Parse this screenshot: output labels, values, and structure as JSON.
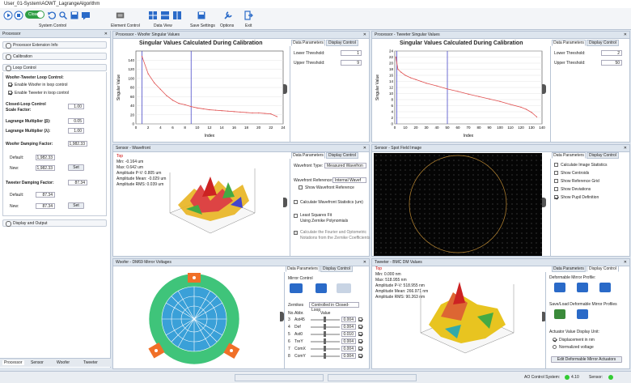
{
  "window": {
    "title": "User_01-System\\AOWT_LagrangeAlgorithm"
  },
  "toolbar": {
    "system_label": "System Control",
    "toggle_label": "Closed",
    "element_label": "Element Control",
    "data_view_label": "Data View",
    "save_label": "Save Settings",
    "options_label": "Options",
    "exit_label": "Exit"
  },
  "left": {
    "title": "Processor",
    "sec_ext": "Processor Extension Info",
    "sec_cal": "Calibration",
    "sec_loop": "Loop Control",
    "loop_heading": "Woofer-Tweeter Loop Control:",
    "cb_woofer": "Enable Woofer in loop control",
    "cb_tweeter": "Enable Tweeter in loop control",
    "cl_label1": "Closed-Loop Control",
    "cl_label2": "Scale Factor:",
    "cl_val": "1.00",
    "lag_b": "Lagrange Multiplier (β):",
    "lag_b_val": "0.05",
    "lag_l": "Lagrange Multiplier (λ):",
    "lag_l_val": "1.00",
    "wd_label": "Woofer Damping Factor:",
    "wd_val": "1,982.33",
    "default_label": "Default:",
    "wd_default": "1,982.33",
    "new_label": "New:",
    "wd_new": "1,982.33",
    "set_label": "Set",
    "td_label": "Tweeter Damping Factor:",
    "td_val": "87.34",
    "td_default": "87.34",
    "td_new": "87.34",
    "sec_disp": "Display and Output",
    "tabs": [
      "Processor",
      "Sensor",
      "Woofer",
      "Tweeter"
    ]
  },
  "woofer_sv": {
    "panel_title": "Processor - Woofer Singular Values",
    "title": "Singular Values Calculated During Calibration",
    "ylabel": "Singular Value",
    "xlabel": "Index",
    "tab1": "Data Parameters",
    "tab2": "Display Control",
    "lower": "Lower Threshold:",
    "lower_val": "1",
    "upper": "Upper Threshold:",
    "upper_val": "9"
  },
  "tweeter_sv": {
    "panel_title": "Processor - Tweeter Singular Values",
    "title": "Singular Values Calculated During Calibration",
    "ylabel": "Singular Value",
    "xlabel": "Index",
    "tab1": "Data Parameters",
    "tab2": "Display Control",
    "lower": "Lower Threshold:",
    "lower_val": "2",
    "upper": "Upper Threshold:",
    "upper_val": "50"
  },
  "wavefront": {
    "panel_title": "Sensor - Wavefront",
    "label": "Top",
    "stats": [
      "Min: -0.164 um",
      "Max: 0.642 um",
      "Amplitude P-V: 0.805 um",
      "Amplitude Mean: -0.029 um",
      "Amplitude RMS: 0.039 um"
    ],
    "tab1": "Data Parameters",
    "tab2": "Display Control",
    "wf_type": "Wavefront Type:",
    "wf_type_val": "Measured Wavefron",
    "wf_ref": "Wavefront Reference:",
    "wf_ref_val": "Internal Wavef",
    "show_ref": "Show Wavefront Reference",
    "calc_stats": "Calculate Wavefront Statistics (um)",
    "lsf1": "Least Squares Fit",
    "lsf2": "Using Zernike Polynomials",
    "fourier1": "Calculate the Fourier and Optometric",
    "fourier2": "Notations from the Zernike Coefficients"
  },
  "spot": {
    "panel_title": "Sensor - Spot Field Image",
    "tab1": "Data Parameters",
    "tab2": "Display Control",
    "opts": [
      "Calculate Image Statistics",
      "Show Centroids",
      "Show Reference Grid",
      "Show Deviations",
      "Show Pupil Definition"
    ]
  },
  "woofer_dm": {
    "panel_title": "Woofer - DM69 Mirror Voltages",
    "tab1": "Data Parameters",
    "tab2": "Display Control",
    "mirror_control": "Mirror Control",
    "zernikes": "Zernikes",
    "zern_mode": "Controlled in Closed-Loop",
    "col_no": "No.",
    "col_abbr": "Abbr.",
    "col_value": "Value",
    "rows": [
      {
        "no": "3",
        "abbr": "Ast45",
        "val": "0.004"
      },
      {
        "no": "4",
        "abbr": "Def",
        "val": "0.004"
      },
      {
        "no": "5",
        "abbr": "Ast0",
        "val": "0.010"
      },
      {
        "no": "6",
        "abbr": "TreY",
        "val": "0.004"
      },
      {
        "no": "7",
        "abbr": "ComX",
        "val": "0.004"
      },
      {
        "no": "8",
        "abbr": "ComY",
        "val": "0.004"
      }
    ]
  },
  "tweeter_dm": {
    "panel_title": "Tweeter - BMC DM Values",
    "label": "Top",
    "stats": [
      "Min: 0.000 nm",
      "Max: 518.955 nm",
      "Amplitude P-V: 518.955 nm",
      "Amplitude Mean: 266.971 nm",
      "Amplitude RMS: 90.263 nm"
    ],
    "tab1": "Data Parameters",
    "tab2": "Display Control",
    "profile": "Deformable Mirror Profile:",
    "saveload": "Save/Load Deformable Mirror Profiles",
    "unit": "Actuator Value Display Unit:",
    "r1": "Displacement in nm",
    "r2": "Normalized voltage",
    "edit": "Edit Deformable Mirror Actuators"
  },
  "status": {
    "ao": "AO Control System:",
    "ao_ver": "4.10",
    "sensor": "Sensor:"
  },
  "chart_data": [
    {
      "type": "line",
      "title": "Singular Values Calculated During Calibration",
      "xlabel": "Index",
      "ylabel": "Singular Value",
      "xlim": [
        0,
        24
      ],
      "ylim": [
        0,
        160
      ],
      "xticks": [
        0,
        2,
        4,
        6,
        8,
        10,
        12,
        14,
        16,
        18,
        20,
        22,
        24
      ],
      "yticks": [
        0,
        20,
        40,
        60,
        80,
        100,
        120,
        140
      ],
      "x": [
        1,
        2,
        3,
        4,
        5,
        6,
        7,
        8,
        9,
        10,
        11,
        12,
        13,
        14,
        15,
        16,
        17,
        18,
        19,
        20,
        21,
        22,
        23
      ],
      "values": [
        148,
        110,
        90,
        76,
        62,
        52,
        45,
        42,
        38,
        35,
        33,
        31,
        30,
        29,
        28,
        27,
        26,
        25,
        24,
        24,
        23,
        22,
        16
      ],
      "thresholds": [
        1,
        9
      ]
    },
    {
      "type": "line",
      "title": "Singular Values Calculated During Calibration",
      "xlabel": "Index",
      "ylabel": "Singular Value",
      "xlim": [
        0,
        140
      ],
      "ylim": [
        0,
        24
      ],
      "xticks": [
        0,
        10,
        20,
        30,
        40,
        50,
        60,
        70,
        80,
        90,
        100,
        110,
        120,
        130,
        140
      ],
      "yticks": [
        0,
        2,
        4,
        6,
        8,
        10,
        12,
        14,
        16,
        18,
        20,
        22,
        24
      ],
      "x": [
        1,
        3,
        6,
        10,
        15,
        20,
        25,
        30,
        40,
        50,
        60,
        70,
        80,
        90,
        100,
        110,
        120,
        125,
        130,
        135
      ],
      "values": [
        22,
        18,
        17,
        16,
        15.2,
        14.6,
        14,
        13.4,
        12.5,
        11.5,
        10.7,
        9.8,
        9.0,
        8.2,
        7.4,
        6.4,
        5.5,
        4.8,
        3.8,
        2.3
      ],
      "thresholds": [
        2,
        50
      ]
    }
  ]
}
